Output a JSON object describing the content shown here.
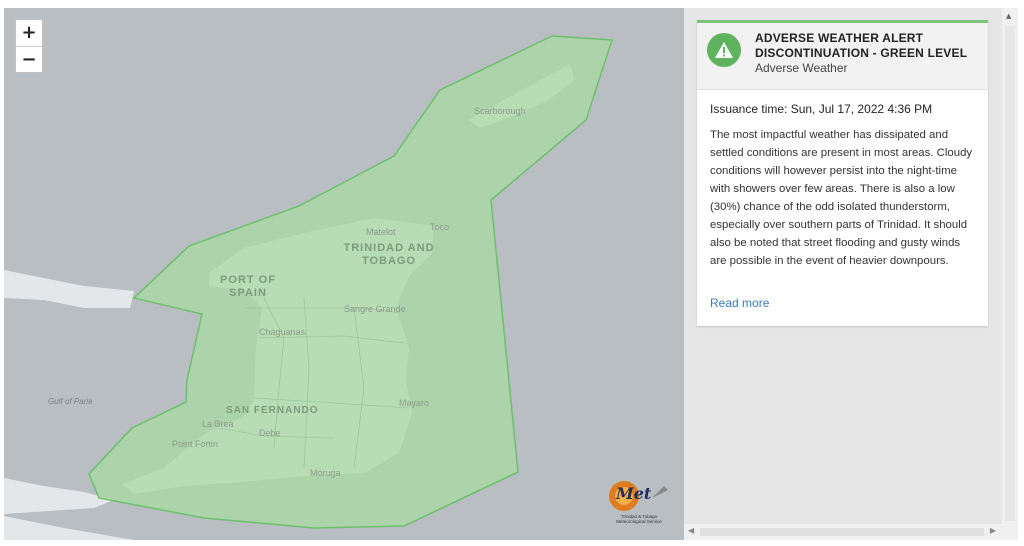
{
  "map": {
    "zoom_in_label": "+",
    "zoom_out_label": "−",
    "labels": {
      "scarborough": "Scarborough",
      "matelot": "Matelot",
      "toco": "Toco",
      "country_line1": "TRINIDAD AND",
      "country_line2": "TOBAGO",
      "port_of_spain_line1": "PORT OF",
      "port_of_spain_line2": "SPAIN",
      "sangre_grande": "Sangre Grande",
      "chaguanas": "Chaguanas",
      "gulf_of_paria": "Gulf of Paria",
      "san_fernando": "SAN FERNANDO",
      "la_brea": "La Brea",
      "mayaro": "Mayaro",
      "point_fortin": "Point Fortin",
      "debe": "Debe",
      "moruga": "Moruga"
    },
    "logo": {
      "text": "Met",
      "subtitle": "Trinidad & Tobago Meteorological Service"
    },
    "colors": {
      "alert_fill": "#a9d9a2",
      "alert_stroke": "#6cc06c",
      "water": "#b9bec3",
      "land": "#e4e7ea"
    }
  },
  "alert": {
    "title": "ADVERSE WEATHER ALERT DISCONTINUATION - GREEN LEVEL",
    "category": "Adverse Weather",
    "issuance": "Issuance time: Sun, Jul 17, 2022 4:36 PM",
    "description": "The most impactful weather has dissipated and settled conditions are present in most areas. Cloudy conditions will however persist into the night-time with showers over few areas. There is also a low (30%) chance of the odd isolated thunderstorm, especially over southern parts of Trinidad. It should also be noted that street flooding and gusty winds are possible in the event of heavier downpours.",
    "read_more": "Read more",
    "level_color": "#5fb35f",
    "icon": "warning-triangle-icon"
  },
  "scrollbars": {
    "up_arrow": "▲",
    "left_arrow": "◀",
    "right_arrow": "▶"
  }
}
